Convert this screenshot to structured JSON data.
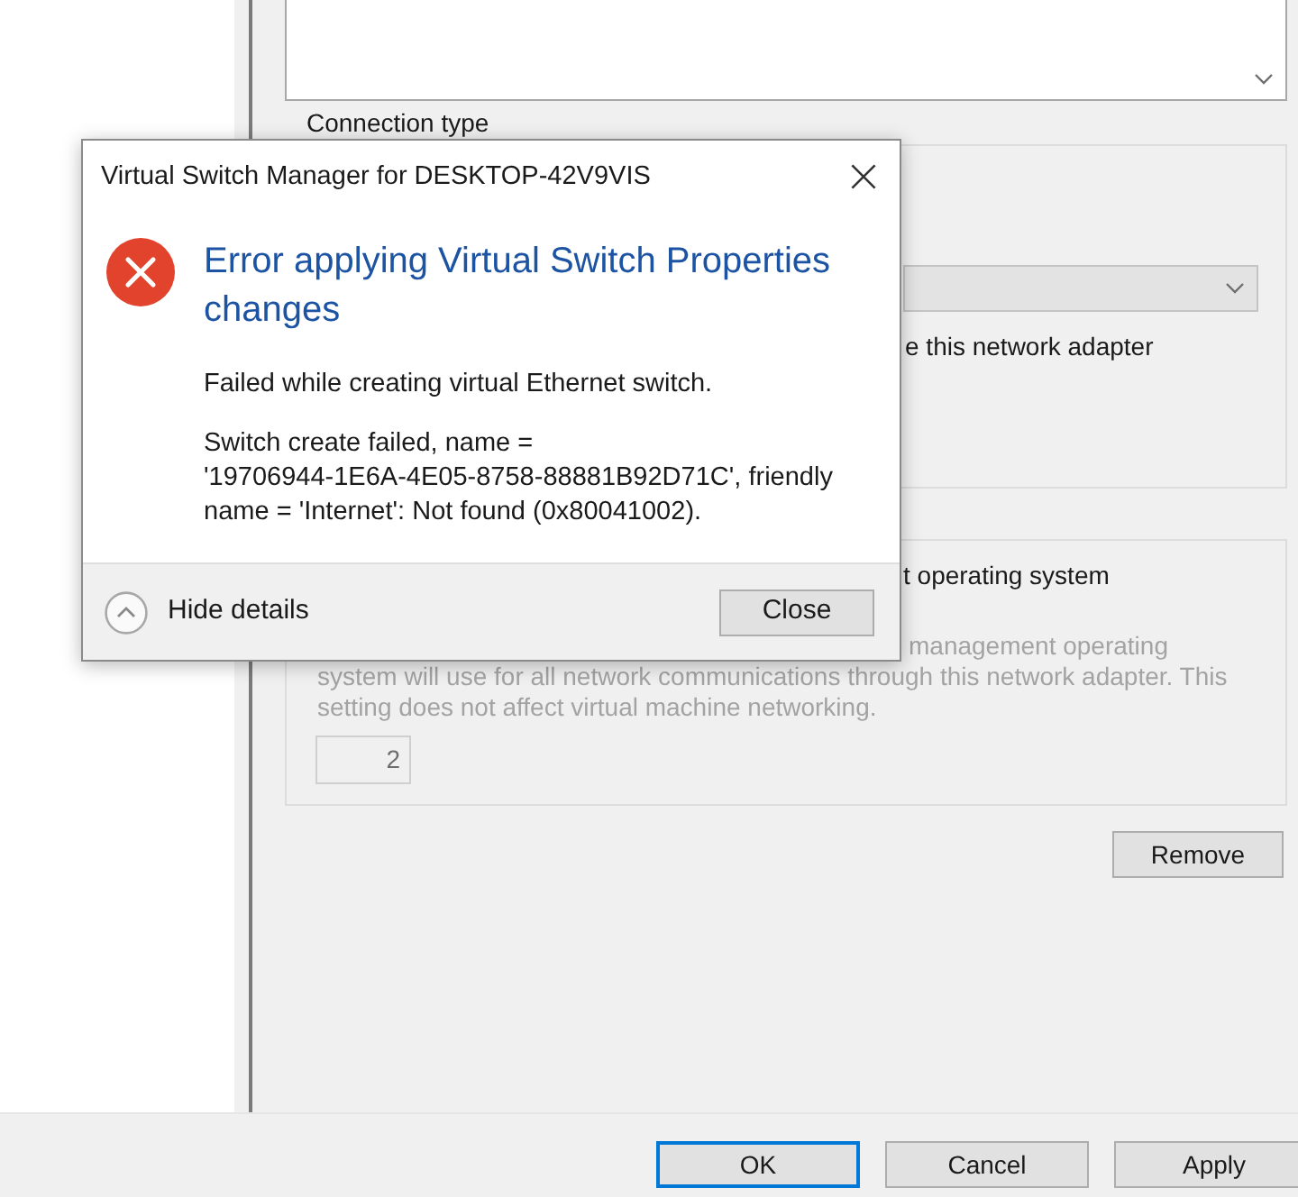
{
  "properties": {
    "connection_type": {
      "label": "Connection type",
      "share_option": {
        "label": "e this network adapter"
      }
    },
    "vlan": {
      "option": {
        "label": "t operating system"
      },
      "description_fragment": "management operating",
      "description": "system will use for all network communications through this network adapter. This setting does not affect virtual machine networking.",
      "disabled": true,
      "vlan_id": {
        "value": "2"
      }
    },
    "remove_button": {
      "label": "Remove"
    }
  },
  "dialog": {
    "title": "Virtual Switch Manager for DESKTOP-42V9VIS",
    "heading": "Error applying Virtual Switch Properties changes",
    "message": "Failed while creating virtual Ethernet switch.",
    "details": "Switch create failed, name = '19706944-1E6A-4E05-8758-88881B92D71C', friendly name = 'Internet': Not found (0x80041002).",
    "details_toggle": {
      "label": "Hide details",
      "expanded": true
    },
    "buttons": [
      {
        "label": "Close"
      }
    ]
  },
  "footer": {
    "buttons": [
      {
        "label": "OK",
        "default": true
      },
      {
        "label": "Cancel",
        "default": false
      },
      {
        "label": "Apply",
        "default": false
      }
    ]
  }
}
